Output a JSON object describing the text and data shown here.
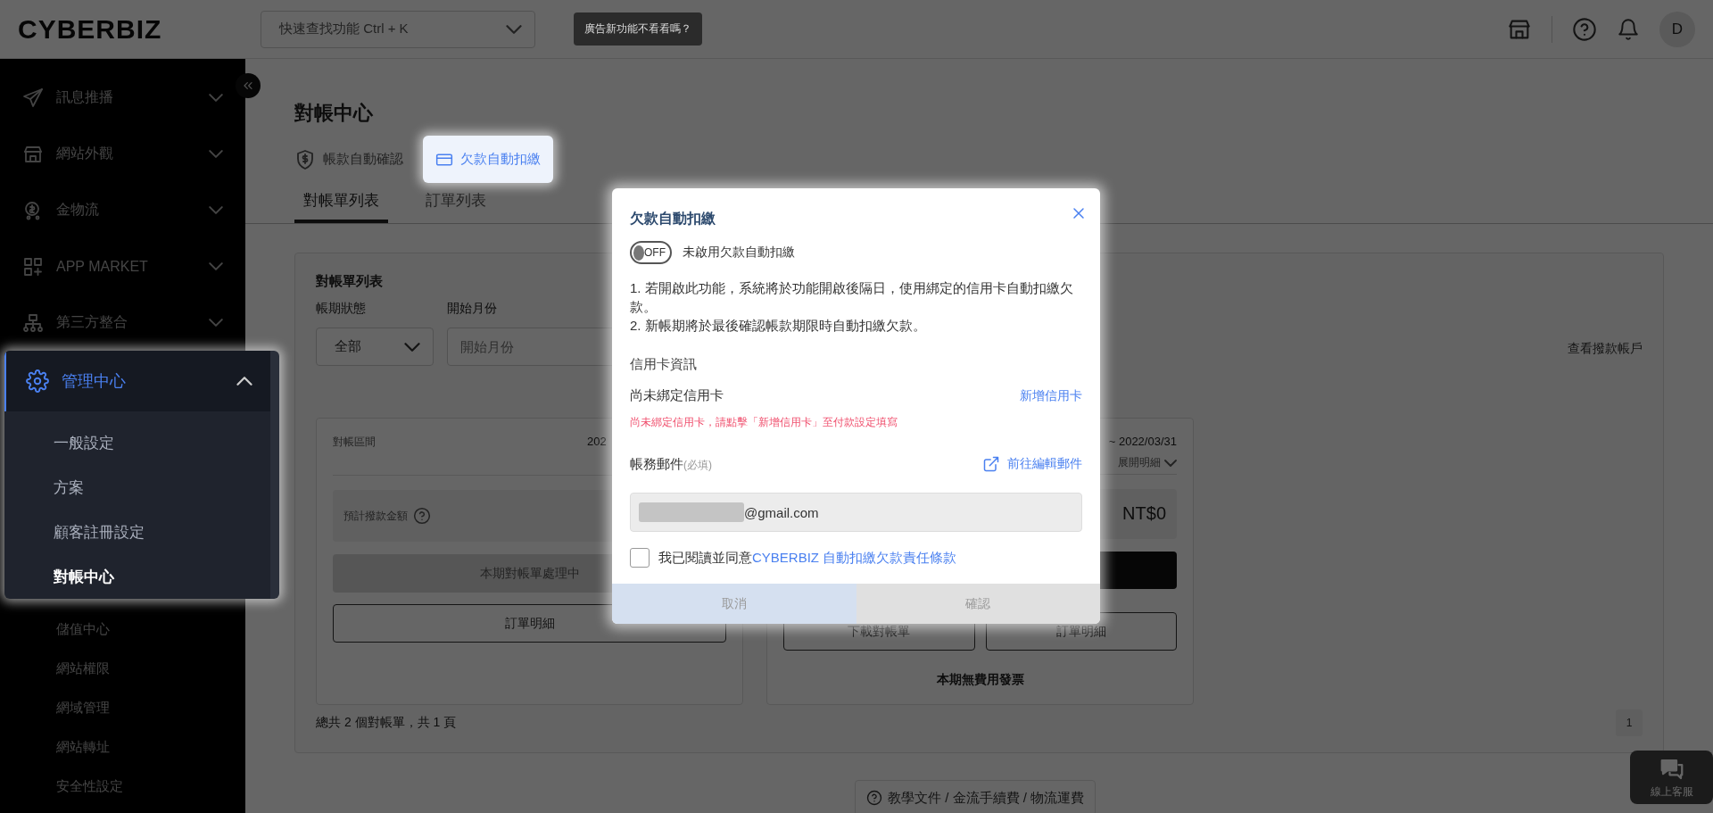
{
  "topbar": {
    "logo": "CYBERBIZ",
    "search": {
      "placeholder": "快速查找功能 Ctrl + K"
    },
    "promo_tip": "廣告新功能不看看嗎？",
    "avatar": "D"
  },
  "sidebar": {
    "items": [
      {
        "label": "訊息推播"
      },
      {
        "label": "網站外觀"
      },
      {
        "label": "金物流"
      },
      {
        "label": "APP MARKET"
      },
      {
        "label": "第三方整合"
      }
    ],
    "menu": {
      "label": "管理中心",
      "expanded": true,
      "children": [
        {
          "label": "一般設定",
          "selected": false
        },
        {
          "label": "方案",
          "selected": false
        },
        {
          "label": "顧客註冊設定",
          "selected": false
        },
        {
          "label": "對帳中心",
          "selected": true
        }
      ]
    },
    "more_items": [
      {
        "label": "儲值中心"
      },
      {
        "label": "網站權限"
      },
      {
        "label": "網域管理"
      },
      {
        "label": "網站轉址"
      },
      {
        "label": "安全性設定"
      }
    ]
  },
  "page": {
    "title": "對帳中心",
    "feature_tabs": [
      {
        "label": "帳款自動確認",
        "selected": false
      },
      {
        "label": "欠款自動扣繳",
        "selected": true
      }
    ],
    "tabs": [
      {
        "label": "對帳單列表",
        "selected": true
      },
      {
        "label": "訂單列表",
        "selected": false
      }
    ]
  },
  "list_card": {
    "title": "對帳單列表",
    "filters": [
      {
        "label": "帳期狀態",
        "kind": "select",
        "value": "全部"
      },
      {
        "label": "開始月份",
        "kind": "input",
        "placeholder": "開始月份"
      }
    ],
    "account_link": "查看撥款帳戶",
    "statements": [
      {
        "period_label": "對帳區間",
        "period": "202",
        "amount_label": "預計撥款金額",
        "status_button": "本期對帳單處理中",
        "buttons": [
          "訂單明細"
        ]
      },
      {
        "period": "~ 2022/03/31",
        "expand": "展開明細",
        "amount": "NT$0",
        "buttons": [
          "下載對帳單",
          "訂單明細"
        ],
        "note": "本期無費用發票"
      }
    ],
    "summary": "總共 2 個對帳單，共 1 頁",
    "page_number": "1"
  },
  "help_link": "教學文件 / 金流手續費 / 物流運費",
  "chat_button": "線上客服",
  "modal": {
    "title": "欠款自動扣繳",
    "toggle": {
      "on": false,
      "text": "OFF"
    },
    "toggle_label": "未啟用欠款自動扣繳",
    "notes": [
      "1. 若開啟此功能，系統將於功能開啟後隔日，使用綁定的信用卡自動扣繳欠款。",
      "2. 新帳期將於最後確認帳款期限時自動扣繳欠款。"
    ],
    "card_heading": "信用卡資訊",
    "card_status": "尚未綁定信用卡",
    "add_card": "新增信用卡",
    "card_warning": "尚未綁定信用卡，請點擊「新增信用卡」至付款設定填寫",
    "email_label": "帳務郵件",
    "email_required": "(必填)",
    "edit_email": "前往編輯郵件",
    "email_value": "@gmail.com",
    "agree": {
      "checked": false,
      "text": "我已閱讀並同意",
      "link": "CYBERBIZ 自動扣繳欠款責任條款"
    },
    "buttons": [
      {
        "label": "取消",
        "kind": "cancel"
      },
      {
        "label": "確認",
        "kind": "confirm"
      }
    ]
  }
}
